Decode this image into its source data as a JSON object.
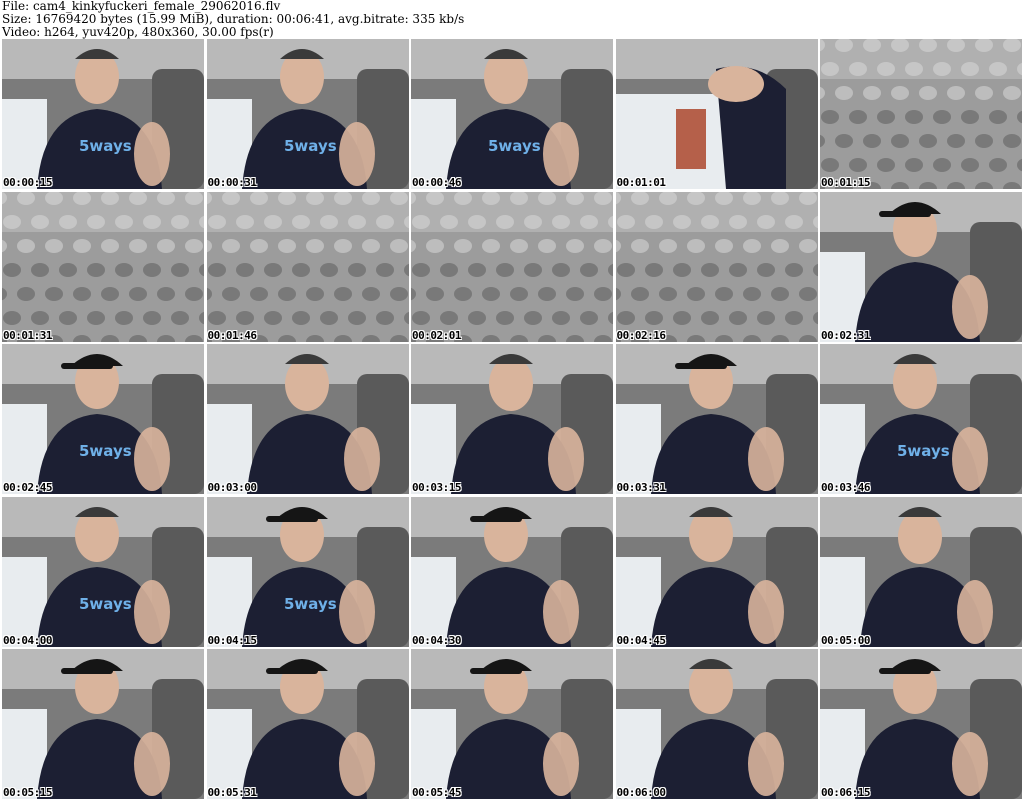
{
  "header": {
    "file_line": "File: cam4_kinkyfuckeri_female_29062016.flv",
    "size_line": "Size: 16769420 bytes (15.99 MiB), duration: 00:06:41, avg.bitrate: 335 kb/s",
    "video_line": "Video: h264, yuv420p, 480x360, 30.00 fps(r)"
  },
  "thumbnails": [
    {
      "timestamp": "00:00:15",
      "scene": "driver",
      "logo": "5ways"
    },
    {
      "timestamp": "00:00:31",
      "scene": "driver",
      "logo": "5ways"
    },
    {
      "timestamp": "00:00:46",
      "scene": "driver",
      "logo": "5ways"
    },
    {
      "timestamp": "00:01:01",
      "scene": "window",
      "logo": ""
    },
    {
      "timestamp": "00:01:15",
      "scene": "ceiling",
      "logo": ""
    },
    {
      "timestamp": "00:01:31",
      "scene": "ceiling",
      "logo": ""
    },
    {
      "timestamp": "00:01:46",
      "scene": "ceiling",
      "logo": ""
    },
    {
      "timestamp": "00:02:01",
      "scene": "ceiling",
      "logo": ""
    },
    {
      "timestamp": "00:02:16",
      "scene": "ceiling",
      "logo": ""
    },
    {
      "timestamp": "00:02:31",
      "scene": "cap",
      "logo": ""
    },
    {
      "timestamp": "00:02:45",
      "scene": "cap",
      "logo": "5ways"
    },
    {
      "timestamp": "00:03:00",
      "scene": "lean",
      "logo": ""
    },
    {
      "timestamp": "00:03:15",
      "scene": "lean",
      "logo": ""
    },
    {
      "timestamp": "00:03:31",
      "scene": "cap",
      "logo": ""
    },
    {
      "timestamp": "00:03:46",
      "scene": "driver",
      "logo": "5ways"
    },
    {
      "timestamp": "00:04:00",
      "scene": "driver",
      "logo": "5ways"
    },
    {
      "timestamp": "00:04:15",
      "scene": "cap",
      "logo": "5ways"
    },
    {
      "timestamp": "00:04:30",
      "scene": "cap",
      "logo": ""
    },
    {
      "timestamp": "00:04:45",
      "scene": "driver",
      "logo": ""
    },
    {
      "timestamp": "00:05:00",
      "scene": "lean",
      "logo": ""
    },
    {
      "timestamp": "00:05:15",
      "scene": "cap",
      "logo": ""
    },
    {
      "timestamp": "00:05:31",
      "scene": "cap",
      "logo": ""
    },
    {
      "timestamp": "00:05:45",
      "scene": "cap",
      "logo": ""
    },
    {
      "timestamp": "00:06:00",
      "scene": "driver",
      "logo": ""
    },
    {
      "timestamp": "00:06:15",
      "scene": "cap",
      "logo": ""
    }
  ],
  "colors": {
    "shirt": "#1c1f33",
    "logo": "#6fb0e8",
    "skin": "#d9b49c",
    "ceiling": "#9c9c9c",
    "seat": "#5a5a5a",
    "window": "#e8ecef"
  }
}
